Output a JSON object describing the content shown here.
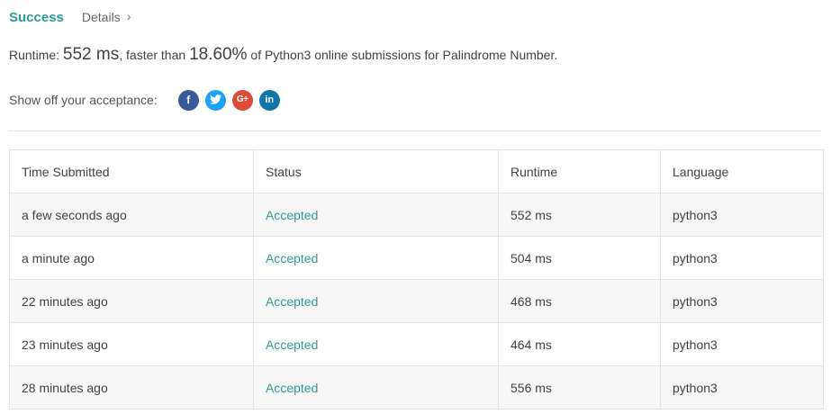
{
  "header": {
    "status": "Success",
    "details_label": "Details",
    "details_chevron": "›"
  },
  "runtime": {
    "prefix": "Runtime: ",
    "value": "552 ms",
    "middle": ", faster than ",
    "percent": "18.60%",
    "suffix": " of Python3 online submissions for Palindrome Number."
  },
  "share": {
    "label": "Show off your acceptance:",
    "buttons": [
      {
        "icon": "facebook-icon",
        "glyph": "f",
        "color": "#3b5998"
      },
      {
        "icon": "twitter-icon",
        "glyph": "🐦",
        "color": "#1da1f2"
      },
      {
        "icon": "google-plus-icon",
        "glyph": "G+",
        "color": "#dd4b39"
      },
      {
        "icon": "linkedin-icon",
        "glyph": "in",
        "color": "#0e76a8"
      }
    ]
  },
  "table": {
    "columns": [
      "Time Submitted",
      "Status",
      "Runtime",
      "Language"
    ],
    "rows": [
      {
        "time": "a few seconds ago",
        "status": "Accepted",
        "runtime": "552 ms",
        "language": "python3"
      },
      {
        "time": "a minute ago",
        "status": "Accepted",
        "runtime": "504 ms",
        "language": "python3"
      },
      {
        "time": "22 minutes ago",
        "status": "Accepted",
        "runtime": "468 ms",
        "language": "python3"
      },
      {
        "time": "23 minutes ago",
        "status": "Accepted",
        "runtime": "464 ms",
        "language": "python3"
      },
      {
        "time": "28 minutes ago",
        "status": "Accepted",
        "runtime": "556 ms",
        "language": "python3"
      }
    ]
  },
  "colors": {
    "accent": "#2e9b94"
  }
}
